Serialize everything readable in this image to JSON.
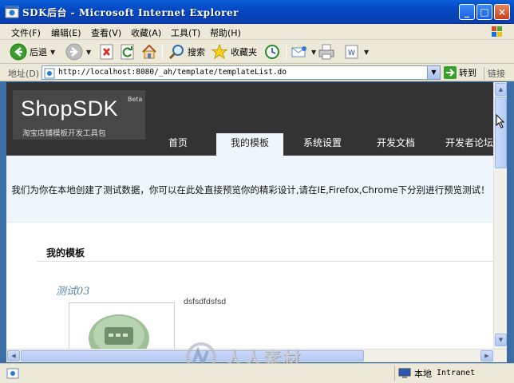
{
  "window": {
    "title": "SDK后台 - Microsoft Internet Explorer",
    "controls": {
      "minimize": "_",
      "maximize": "□",
      "close": "×"
    }
  },
  "menu": {
    "items": [
      {
        "label": "文件(F)"
      },
      {
        "label": "编辑(E)"
      },
      {
        "label": "查看(V)"
      },
      {
        "label": "收藏(A)"
      },
      {
        "label": "工具(T)"
      },
      {
        "label": "帮助(H)"
      }
    ]
  },
  "toolbar": {
    "back_label": "后退",
    "search_label": "搜索",
    "favorites_label": "收藏夹"
  },
  "address": {
    "label": "地址(D)",
    "url": "http://localhost:8080/_ah/template/templateList.do",
    "go_label": "转到",
    "links_label": "链接"
  },
  "site": {
    "logo": "ShopSDK",
    "beta": "Beta",
    "tagline": "淘宝店铺模板开发工具包",
    "nav": [
      {
        "label": "首页",
        "active": false
      },
      {
        "label": "我的模板",
        "active": true
      },
      {
        "label": "系统设置",
        "active": false
      },
      {
        "label": "开发文档",
        "active": false
      },
      {
        "label": "开发者论坛",
        "active": false
      }
    ],
    "notice": "我们为你在本地创建了测试数据，你可以在此处直接预览你的精彩设计,请在IE,Firefox,Chrome下分别进行预览测试！",
    "section_title": "我的模板",
    "template": {
      "name": "测试03",
      "description": "dsfsdfdsfsd"
    }
  },
  "status": {
    "zone_label": "本地",
    "zone_en": "Intranet"
  },
  "watermark": "人人素材",
  "colors": {
    "header_bg": "#333333",
    "notice_bg": "#eef6fb",
    "title_bar": "#0449c2"
  }
}
